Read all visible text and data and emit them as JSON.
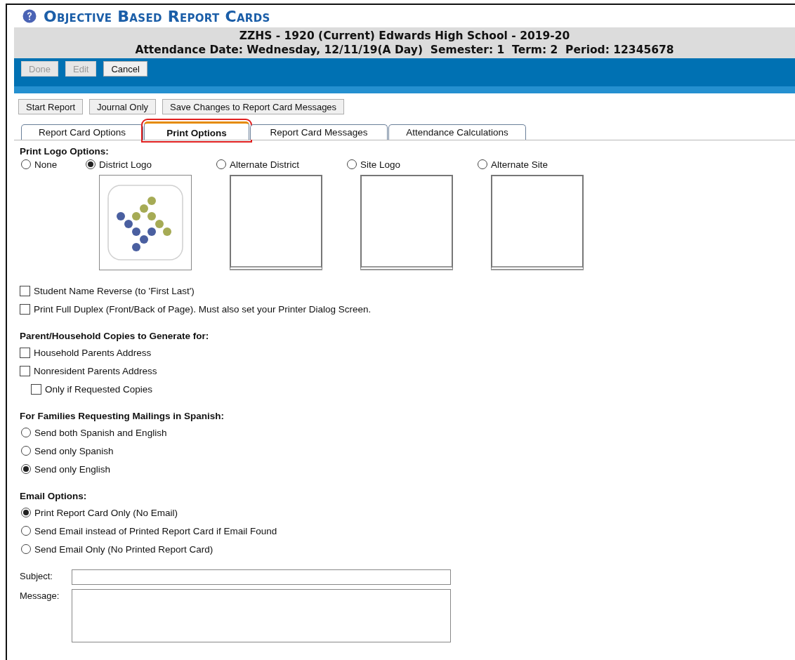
{
  "page_title": "Objective Based Report Cards",
  "header": {
    "school": "ZZHS - 1920 (Current) Edwards High School - 2019-20",
    "attendance": "Attendance Date: Wednesday, 12/11/19(A Day)  Semester: 1  Term: 2  Period: 12345678"
  },
  "toolbar_buttons": [
    {
      "label": "Done",
      "disabled": true
    },
    {
      "label": "Edit",
      "disabled": true
    },
    {
      "label": "Cancel",
      "disabled": false
    }
  ],
  "action_buttons": [
    "Start Report",
    "Journal Only",
    "Save Changes to Report Card Messages"
  ],
  "tabs": [
    {
      "label": "Report Card Options",
      "selected": false,
      "highlighted": false
    },
    {
      "label": "Print Options",
      "selected": true,
      "highlighted": true
    },
    {
      "label": "Report Card Messages",
      "selected": false,
      "highlighted": false
    },
    {
      "label": "Attendance Calculations",
      "selected": false,
      "highlighted": false
    }
  ],
  "logo_section": {
    "heading": "Print Logo Options:",
    "options": [
      {
        "label": "None",
        "selected": false
      },
      {
        "label": "District Logo",
        "selected": true,
        "kind": "logo"
      },
      {
        "label": "Alternate District",
        "selected": false,
        "kind": "frame"
      },
      {
        "label": "Site Logo",
        "selected": false,
        "kind": "frame"
      },
      {
        "label": "Alternate Site",
        "selected": false,
        "kind": "frame"
      }
    ]
  },
  "print_checkboxes": [
    {
      "label": "Student Name Reverse (to 'First Last')",
      "checked": false
    },
    {
      "label": "Print Full Duplex (Front/Back of Page). Must also set your Printer Dialog Screen.",
      "checked": false
    }
  ],
  "copies_section": {
    "heading": "Parent/Household Copies to Generate for:",
    "items": [
      {
        "label": "Household Parents Address",
        "checked": false
      },
      {
        "label": "Nonresident Parents Address",
        "checked": false,
        "children": [
          {
            "label": "Only if Requested Copies",
            "checked": false
          }
        ]
      }
    ]
  },
  "spanish_section": {
    "heading": "For Families Requesting Mailings in Spanish:",
    "options": [
      {
        "label": "Send both Spanish and English",
        "selected": false
      },
      {
        "label": "Send only Spanish",
        "selected": false
      },
      {
        "label": "Send only English",
        "selected": true
      }
    ]
  },
  "email_section": {
    "heading": "Email Options:",
    "options": [
      {
        "label": "Print Report Card Only (No Email)",
        "selected": true
      },
      {
        "label": "Send Email instead of Printed Report Card if Email Found",
        "selected": false
      },
      {
        "label": "Send Email Only (No Printed Report Card)",
        "selected": false
      }
    ]
  },
  "email_fields": [
    {
      "label": "Subject:",
      "kind": "line"
    },
    {
      "label": "Message:",
      "kind": "area"
    }
  ]
}
